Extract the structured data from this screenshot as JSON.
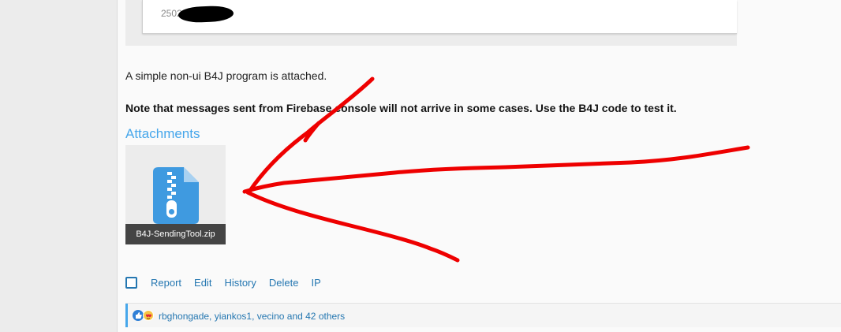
{
  "code_block": {
    "visible_text": "2502"
  },
  "post": {
    "paragraph_1": "A simple non-ui B4J program is attached.",
    "paragraph_2": "Note that messages sent from Firebase console will not arrive in some cases. Use the B4J code to test it."
  },
  "attachments": {
    "heading": "Attachments",
    "items": [
      {
        "name": "B4J-SendingTool.zip",
        "icon": "zip-file-icon"
      }
    ]
  },
  "actions": {
    "items": [
      {
        "label": "Report"
      },
      {
        "label": "Edit"
      },
      {
        "label": "History"
      },
      {
        "label": "Delete"
      },
      {
        "label": "IP"
      }
    ]
  },
  "reactions": {
    "icons": [
      "like-icon",
      "love-icon"
    ],
    "text": "rbghongade, yiankos1, vecino and 42 others"
  },
  "colors": {
    "link": "#2577b1",
    "heading_accent": "#47a7eb",
    "annotation_red": "#ee0000"
  }
}
